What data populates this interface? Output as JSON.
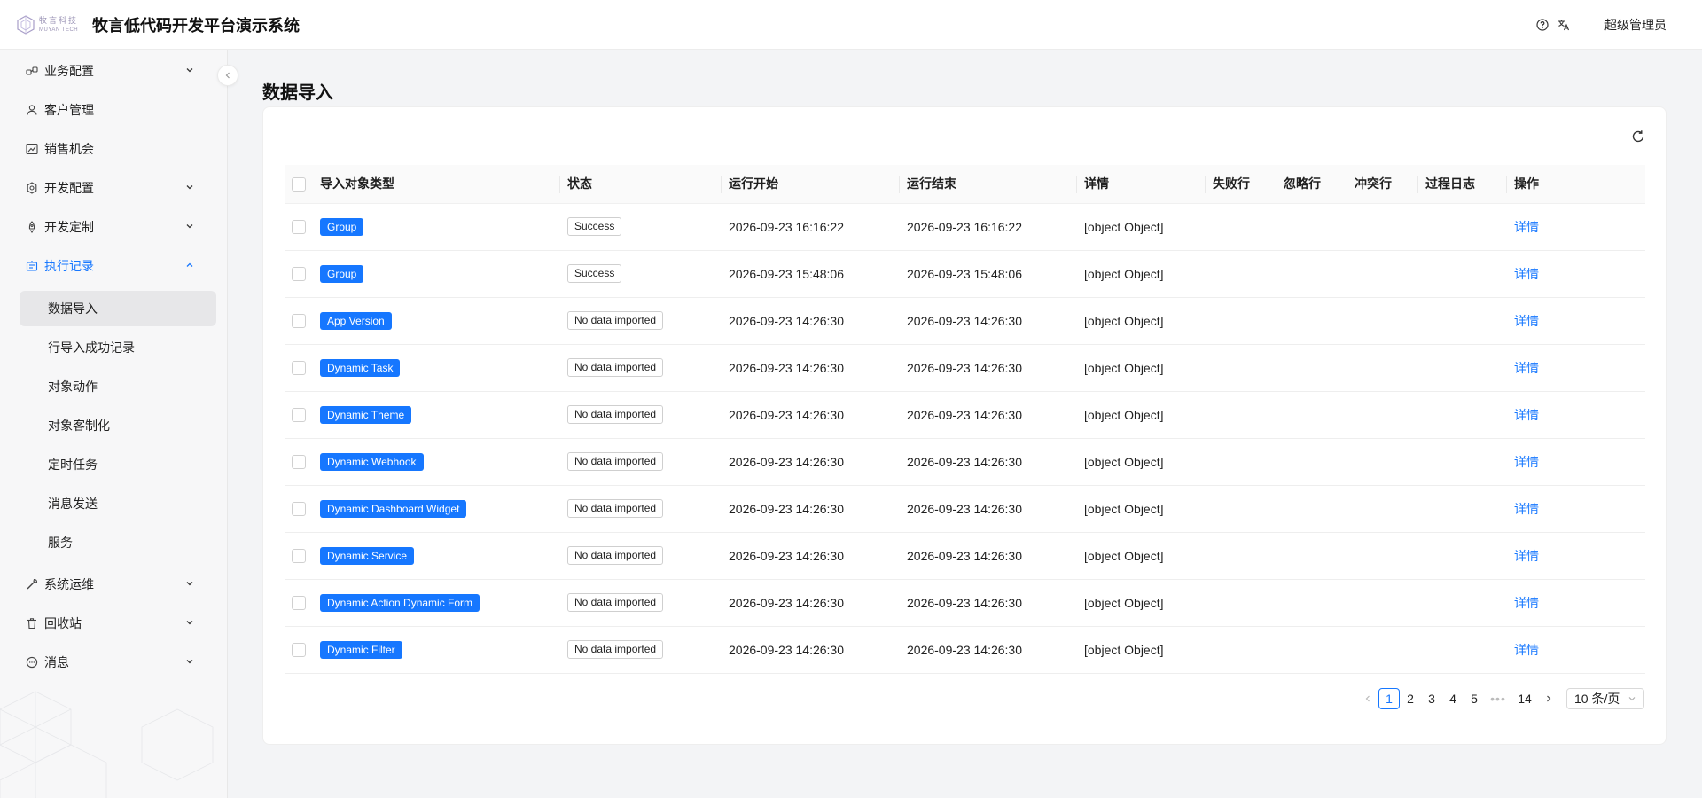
{
  "header": {
    "logo_cn": "牧言科技",
    "logo_en": "MUYAN TECH",
    "title": "牧言低代码开发平台演示系统",
    "help_icon": "help-circle-icon",
    "lang_icon": "translate-icon",
    "user": "超级管理员"
  },
  "sidebar": {
    "menu": [
      {
        "label": "业务配置",
        "icon": "link-icon"
      },
      {
        "label": "客户管理",
        "icon": "user-icon"
      },
      {
        "label": "销售机会",
        "icon": "chart-icon"
      },
      {
        "label": "开发配置",
        "icon": "gear-icon"
      },
      {
        "label": "开发定制",
        "icon": "rocket-icon"
      },
      {
        "label": "执行记录",
        "icon": "robot-icon"
      },
      {
        "label": "系统运维",
        "icon": "wrench-icon"
      },
      {
        "label": "回收站",
        "icon": "trash-icon"
      },
      {
        "label": "消息",
        "icon": "message-icon"
      }
    ],
    "submenu": [
      {
        "label": "数据导入"
      },
      {
        "label": "行导入成功记录"
      },
      {
        "label": "对象动作"
      },
      {
        "label": "对象客制化"
      },
      {
        "label": "定时任务"
      },
      {
        "label": "消息发送"
      },
      {
        "label": "服务"
      }
    ]
  },
  "main": {
    "title": "数据导入",
    "columns": [
      "导入对象类型",
      "状态",
      "运行开始",
      "运行结束",
      "详情",
      "失败行",
      "忽略行",
      "冲突行",
      "过程日志",
      "操作"
    ],
    "rows": [
      {
        "type": "Group",
        "status": "Success",
        "start": "2026-09-23 16:16:22",
        "end": "2026-09-23 16:16:22",
        "detail": "[object Object]",
        "failed": "",
        "ignored": "",
        "conflict": "",
        "log": "",
        "action": "详情"
      },
      {
        "type": "Group",
        "status": "Success",
        "start": "2026-09-23 15:48:06",
        "end": "2026-09-23 15:48:06",
        "detail": "[object Object]",
        "failed": "",
        "ignored": "",
        "conflict": "",
        "log": "",
        "action": "详情"
      },
      {
        "type": "App Version",
        "status": "No data imported",
        "start": "2026-09-23 14:26:30",
        "end": "2026-09-23 14:26:30",
        "detail": "[object Object]",
        "failed": "",
        "ignored": "",
        "conflict": "",
        "log": "",
        "action": "详情"
      },
      {
        "type": "Dynamic Task",
        "status": "No data imported",
        "start": "2026-09-23 14:26:30",
        "end": "2026-09-23 14:26:30",
        "detail": "[object Object]",
        "failed": "",
        "ignored": "",
        "conflict": "",
        "log": "",
        "action": "详情"
      },
      {
        "type": "Dynamic Theme",
        "status": "No data imported",
        "start": "2026-09-23 14:26:30",
        "end": "2026-09-23 14:26:30",
        "detail": "[object Object]",
        "failed": "",
        "ignored": "",
        "conflict": "",
        "log": "",
        "action": "详情"
      },
      {
        "type": "Dynamic Webhook",
        "status": "No data imported",
        "start": "2026-09-23 14:26:30",
        "end": "2026-09-23 14:26:30",
        "detail": "[object Object]",
        "failed": "",
        "ignored": "",
        "conflict": "",
        "log": "",
        "action": "详情"
      },
      {
        "type": "Dynamic Dashboard Widget",
        "status": "No data imported",
        "start": "2026-09-23 14:26:30",
        "end": "2026-09-23 14:26:30",
        "detail": "[object Object]",
        "failed": "",
        "ignored": "",
        "conflict": "",
        "log": "",
        "action": "详情"
      },
      {
        "type": "Dynamic Service",
        "status": "No data imported",
        "start": "2026-09-23 14:26:30",
        "end": "2026-09-23 14:26:30",
        "detail": "[object Object]",
        "failed": "",
        "ignored": "",
        "conflict": "",
        "log": "",
        "action": "详情"
      },
      {
        "type": "Dynamic Action Dynamic Form",
        "status": "No data imported",
        "start": "2026-09-23 14:26:30",
        "end": "2026-09-23 14:26:30",
        "detail": "[object Object]",
        "failed": "",
        "ignored": "",
        "conflict": "",
        "log": "",
        "action": "详情"
      },
      {
        "type": "Dynamic Filter",
        "status": "No data imported",
        "start": "2026-09-23 14:26:30",
        "end": "2026-09-23 14:26:30",
        "detail": "[object Object]",
        "failed": "",
        "ignored": "",
        "conflict": "",
        "log": "",
        "action": "详情"
      }
    ]
  },
  "pagination": {
    "pages": [
      "1",
      "2",
      "3",
      "4",
      "5"
    ],
    "ellipsis": "•••",
    "last": "14",
    "current": "1",
    "page_size": "10 条/页"
  },
  "colors": {
    "accent": "#1677ff",
    "tag_bg": "#1677ff"
  }
}
